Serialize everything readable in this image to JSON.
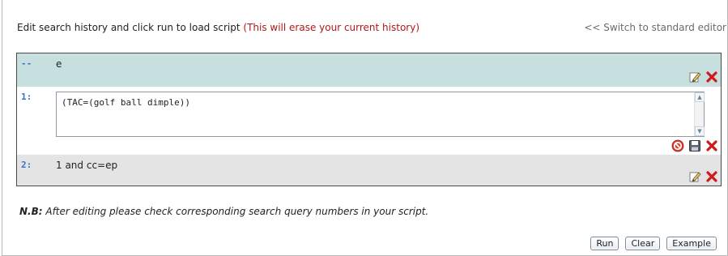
{
  "header": {
    "instruction": "Edit search history and click run to load script",
    "warning": "(This will erase your current history)",
    "switch_link": "<< Switch to standard editor"
  },
  "editor": {
    "rows": [
      {
        "number": "--",
        "text": "e",
        "actions": [
          "edit-icon",
          "delete-icon"
        ]
      },
      {
        "number": "1:",
        "text": "(TAC=(golf ball dimple))",
        "editing": true,
        "actions": [
          "cancel-icon",
          "save-icon",
          "delete-icon"
        ]
      },
      {
        "number": "2:",
        "text": "1 and cc=ep",
        "actions": [
          "edit-icon",
          "delete-icon"
        ]
      }
    ]
  },
  "note": {
    "label": "N.B:",
    "text": "After editing please check corresponding search query numbers in your script."
  },
  "buttons": {
    "run": "Run",
    "clear": "Clear",
    "example": "Example"
  },
  "colors": {
    "row_header_bg": "#c8dfe0",
    "row_alt_bg": "#e4e4e4",
    "number_color": "#3a73c9",
    "warning_color": "#b0181a",
    "delete_color": "#d01a1a"
  }
}
